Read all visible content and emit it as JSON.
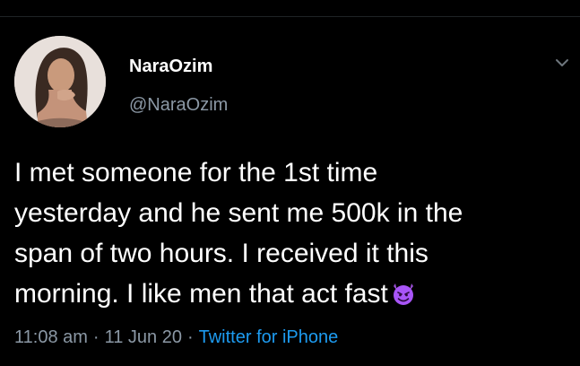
{
  "tweet": {
    "author": {
      "display_name": "NaraOzim",
      "handle": "@NaraOzim",
      "avatar_icon": "profile-photo"
    },
    "text_lines": [
      "I met someone for the 1st time",
      "yesterday and he sent me 500k in the",
      "span of two hours. I received it this",
      "morning. I like men that act fast"
    ],
    "emoji": "smiling-imp-emoji",
    "time": "11:08 am",
    "date": "11 Jun 20",
    "separator": "·",
    "source": "Twitter for iPhone",
    "menu_icon": "chevron-down-icon"
  },
  "colors": {
    "background": "#000000",
    "text": "#ffffff",
    "muted": "#8b98a5",
    "link": "#1d9bf0",
    "emoji_purple": "#a855f7"
  }
}
